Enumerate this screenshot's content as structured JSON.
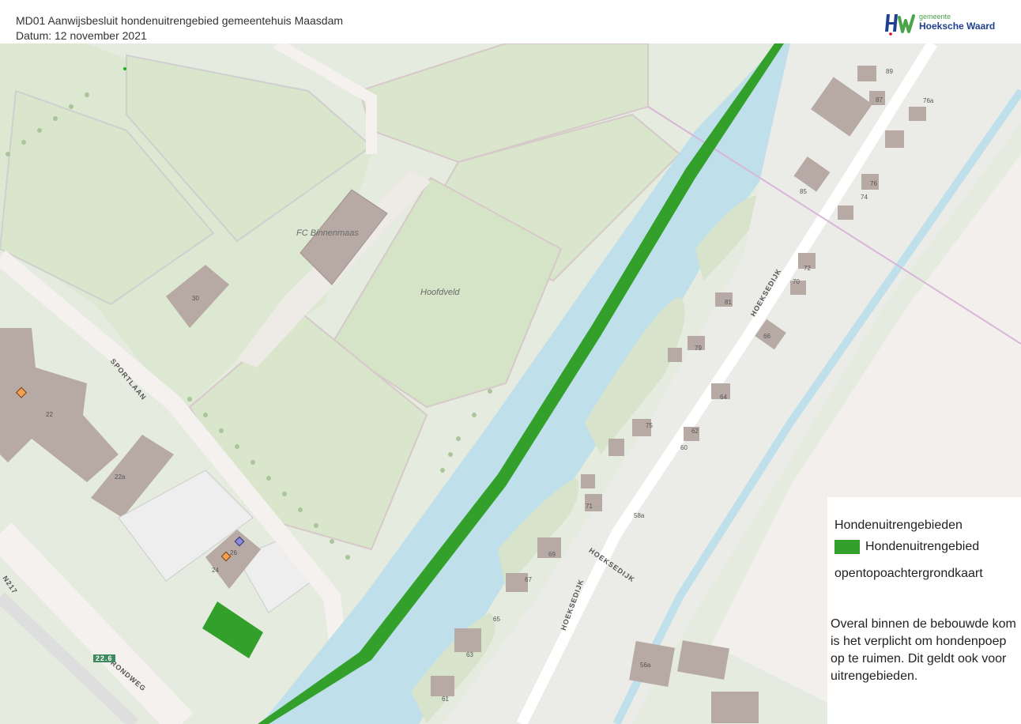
{
  "header": {
    "title": "MD01 Aanwijsbesluit hondenuitrengebied gemeentehuis Maasdam",
    "date": "Datum: 12 november 2021",
    "logo_small": "gemeente",
    "logo_big": "Hoeksche Waard"
  },
  "map": {
    "labels": {
      "club": "FC Binnenmaas",
      "field": "Hoofdveld"
    },
    "streets": {
      "sportlaan": "SPORTLAAN",
      "hoeksedijk": "HOEKSEDIJK",
      "rondweg": "RONDWEG",
      "n217": "N217",
      "km": "22.6"
    },
    "house_numbers": [
      "89",
      "87",
      "76a",
      "85",
      "76",
      "74",
      "81",
      "72",
      "70",
      "79",
      "66",
      "64",
      "75",
      "62",
      "60",
      "71",
      "58a",
      "69",
      "67",
      "65",
      "63",
      "61",
      "56a",
      "30",
      "22",
      "22a",
      "26",
      "24"
    ],
    "colors": {
      "dog_area": "#33a02c",
      "water": "#bfe0ea",
      "grass": "#e3ecd9",
      "building": "#b7a9a4"
    }
  },
  "legend": {
    "title": "Hondenuitrengebieden",
    "item_label": "Hondenuitrengebied",
    "basemap_label": "opentopoachtergrondkaart",
    "note": "Overal binnen de bebouwde kom is het verplicht om hondenpoep op te ruimen. Dit geldt ook voor uitrengebieden."
  }
}
